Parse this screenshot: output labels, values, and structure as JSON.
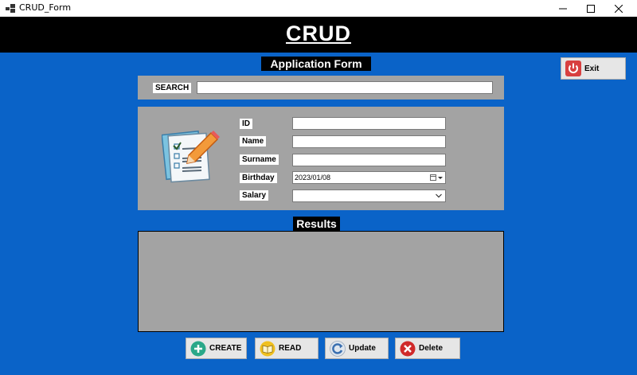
{
  "window": {
    "title": "CRUD_Form"
  },
  "header": {
    "title": "CRUD"
  },
  "form": {
    "section_title": "Application Form",
    "search_label": "SEARCH",
    "search_value": "",
    "fields": {
      "id_label": "ID",
      "name_label": "Name",
      "surname_label": "Surname",
      "birthday_label": "Birthday",
      "birthday_value": "2023/01/08",
      "salary_label": "Salary"
    }
  },
  "results": {
    "title": "Results"
  },
  "buttons": {
    "exit": "Exit",
    "create": "CREATE",
    "read": "READ",
    "update": "Update",
    "delete": "Delete"
  },
  "colors": {
    "background": "#0a63c8",
    "panel": "#a3a3a3",
    "banner": "#000000",
    "create_icon": "#2aa889",
    "read_icon": "#f0c020",
    "update_icon": "#3a6fb0",
    "delete_icon": "#d02a2a",
    "exit_icon": "#d84040"
  }
}
